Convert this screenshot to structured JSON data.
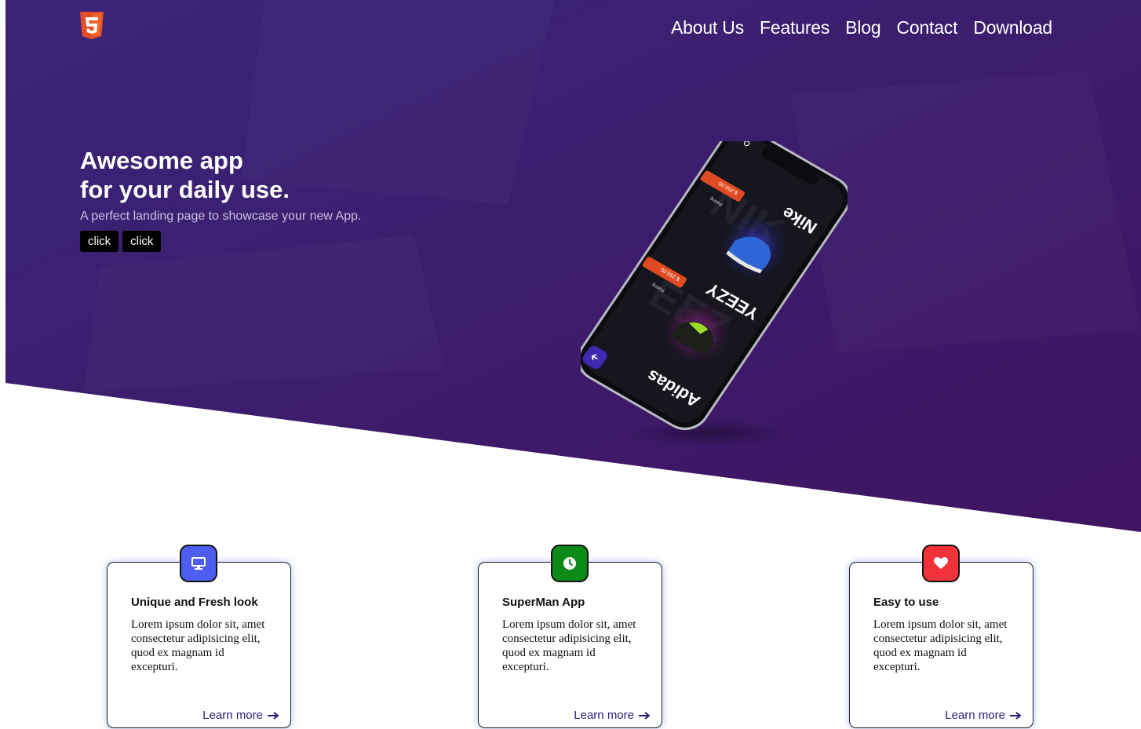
{
  "colors": {
    "hero_start": "#3a2579",
    "hero_end": "#3f1460",
    "html5_orange": "#e44d26",
    "card_blue": "#4d5df0",
    "card_green": "#0b8a16",
    "card_red": "#f2323a",
    "link": "#2d1a78"
  },
  "header": {
    "logo_icon": "html5-logo-icon",
    "nav": [
      "About Us",
      "Features",
      "Blog",
      "Contact",
      "Download"
    ]
  },
  "hero": {
    "title_line1": "Awesome app",
    "title_line2": "for your daily use.",
    "subtitle": "A perfect landing page to showcase your new App.",
    "buttons": [
      "click",
      "click"
    ]
  },
  "phone": {
    "brands": [
      "Nike",
      "YEEZY",
      "Adidas"
    ],
    "price_tags": [
      "$ 250.00",
      "$ 250.00"
    ],
    "rating_label": "Rating"
  },
  "features": [
    {
      "icon": "monitor-icon",
      "title": "Unique and Fresh look",
      "text": "Lorem ipsum dolor sit, amet consectetur adipisicing elit, quod ex magnam id excepturi.",
      "link": "Learn more"
    },
    {
      "icon": "clock-icon",
      "title": "SuperMan App",
      "text": "Lorem ipsum dolor sit, amet consectetur adipisicing elit, quod ex magnam id excepturi.",
      "link": "Learn more"
    },
    {
      "icon": "heart-icon",
      "title": "Easy to use",
      "text": "Lorem ipsum dolor sit, amet consectetur adipisicing elit, quod ex magnam id excepturi.",
      "link": "Learn more"
    }
  ]
}
